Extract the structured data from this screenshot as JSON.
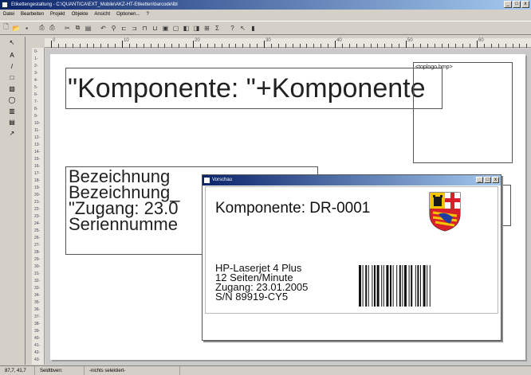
{
  "window": {
    "title": "Etikettengestaltung - C:\\QUANTICA\\EXT_Mobile\\AKZ-HT-Etiketten\\barcode\\lbl",
    "buttons": [
      "_",
      "□",
      "x"
    ]
  },
  "menu": [
    "Datei",
    "Bearbeiten",
    "Projekt",
    "Objekte",
    "Ansicht",
    "Optionen...",
    "?"
  ],
  "ruler": {
    "horizontal_labels": [
      "0",
      "10",
      "20",
      "30",
      "40",
      "50",
      "60"
    ],
    "vertical_labels": [
      "0-",
      "1-",
      "2-",
      "3-",
      "4-",
      "5-",
      "6-",
      "7-",
      "8-",
      "9-",
      "10-",
      "11-",
      "12-",
      "13-",
      "14-",
      "15-",
      "16-",
      "17-",
      "18-",
      "19-",
      "20-",
      "21-",
      "22-",
      "23-",
      "24-",
      "25-",
      "26-",
      "27-",
      "28-",
      "29-",
      "30-",
      "31-",
      "32-",
      "33-",
      "34-",
      "35-",
      "36-",
      "37-",
      "38-",
      "39-",
      "40-",
      "41-",
      "42-",
      "43-"
    ]
  },
  "design": {
    "big_field": "\"Komponente: \"+Komponente",
    "logo_field": "<toplogo.bmp>",
    "text_lines": [
      "Bezeichnung",
      "Bezeichnung_",
      "\"Zugang: 23.0",
      "Seriennumme"
    ]
  },
  "preview": {
    "title": "Vorschau",
    "heading": "Komponente: DR-0001",
    "lines": [
      "HP-Laserjet 4 Plus",
      "12 Seiten/Minute",
      "Zugang: 23.01.2005",
      "S/N 89919-CY5"
    ],
    "crest_colors": {
      "red": "#d8202a",
      "yellow": "#f5c400",
      "blue": "#1f3fa0",
      "black": "#1a1a1a"
    }
  },
  "status": [
    "87,7, 41,7",
    "Seldtbven:",
    "-nichts selektiert-"
  ],
  "icons": [
    "new-icon",
    "open-icon",
    "save-icon",
    "print-icon",
    "print-preview-icon",
    "cut-icon",
    "copy-icon",
    "paste-icon",
    "undo-icon",
    "zoom-icon",
    "help-icon",
    "pointer-icon",
    "text-tool-icon",
    "line-tool-icon",
    "rect-tool-icon",
    "image-tool-icon",
    "barcode-tool-icon"
  ]
}
